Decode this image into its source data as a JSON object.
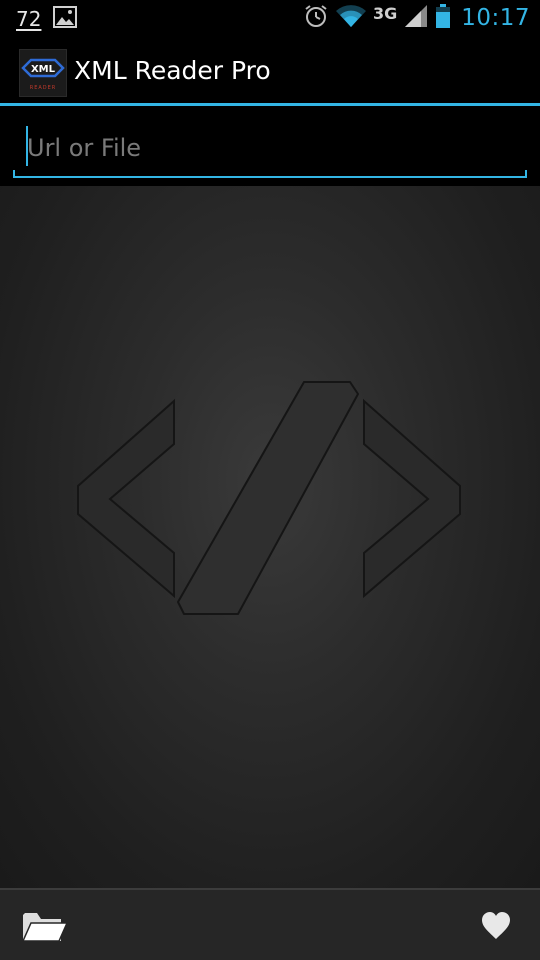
{
  "status_bar": {
    "notification_number": "72",
    "network_type": "3G",
    "time": "10:17",
    "accent_color": "#33b5e5",
    "icons": [
      "gallery-icon",
      "alarm-icon",
      "wifi-icon",
      "signal-icon",
      "battery-icon"
    ]
  },
  "action_bar": {
    "title": "XML Reader Pro",
    "app_icon": {
      "text": "XML",
      "subtext": "READER"
    }
  },
  "input": {
    "placeholder": "Url or File",
    "value": ""
  },
  "content": {
    "logo_icon": "xml-code-brackets-icon"
  },
  "bottom_bar": {
    "left_icon": "folder-open-icon",
    "right_icon": "heart-icon"
  }
}
